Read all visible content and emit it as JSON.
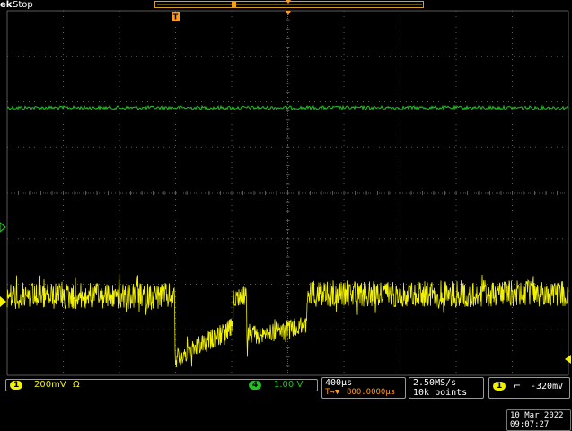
{
  "header": {
    "brand": "ek",
    "state": "Stop",
    "trigger_marker": "T",
    "position_marker": "T"
  },
  "colors": {
    "ch1": "#f2f200",
    "ch4": "#22c022",
    "trigger": "#ff9a1a",
    "grid": "#5a5a5a"
  },
  "channels": {
    "ch1": {
      "number": "1",
      "scale": "200mV",
      "coupling": "Ω"
    },
    "ch4": {
      "number": "4",
      "scale": "1.00 V"
    }
  },
  "timebase": {
    "scale": "400µs",
    "position_icon": "T→▼",
    "position": "800.0000µs"
  },
  "acquisition": {
    "sample_rate": "2.50MS/s",
    "record_length": "10k points"
  },
  "trigger": {
    "source": "1",
    "slope_icon": "falling-edge-icon",
    "slope_glyph": "⌐",
    "level": "-320mV"
  },
  "datetime": {
    "date": "10 Mar  2022",
    "time": "09:07:27"
  }
}
